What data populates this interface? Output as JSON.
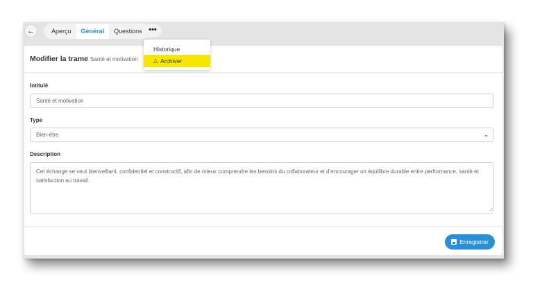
{
  "nav": {
    "back_icon": "arrow-left-icon",
    "back_glyph": "←",
    "tabs": [
      {
        "label": "Aperçu"
      },
      {
        "label": "Général"
      },
      {
        "label": "Questions"
      }
    ],
    "active_tab": "Général",
    "more_glyph": "•••"
  },
  "menu": {
    "items": [
      {
        "label": "Historique"
      },
      {
        "label": "Archiver"
      }
    ],
    "highlight_color": "#f7e600",
    "archive_icon": "flask-icon"
  },
  "card": {
    "title": "Modifier la trame",
    "subtitle": "Santé et motivation"
  },
  "form": {
    "intitule_label": "Intitulé",
    "intitule_value": "Santé et motivation",
    "type_label": "Type",
    "type_value": "Bien-être",
    "description_label": "Description",
    "description_value": "Cet échange se veut bienveillant, confidentiel et constructif, afin de mieux comprendre les besoins du collaborateur et d’encourager un équilibre durable entre performance, santé et satisfaction au travail."
  },
  "actions": {
    "save_label": "Enregistrer",
    "save_icon": "floppy-disk-icon"
  },
  "colors": {
    "accent": "#2b8fd6",
    "highlight": "#f7e600"
  }
}
